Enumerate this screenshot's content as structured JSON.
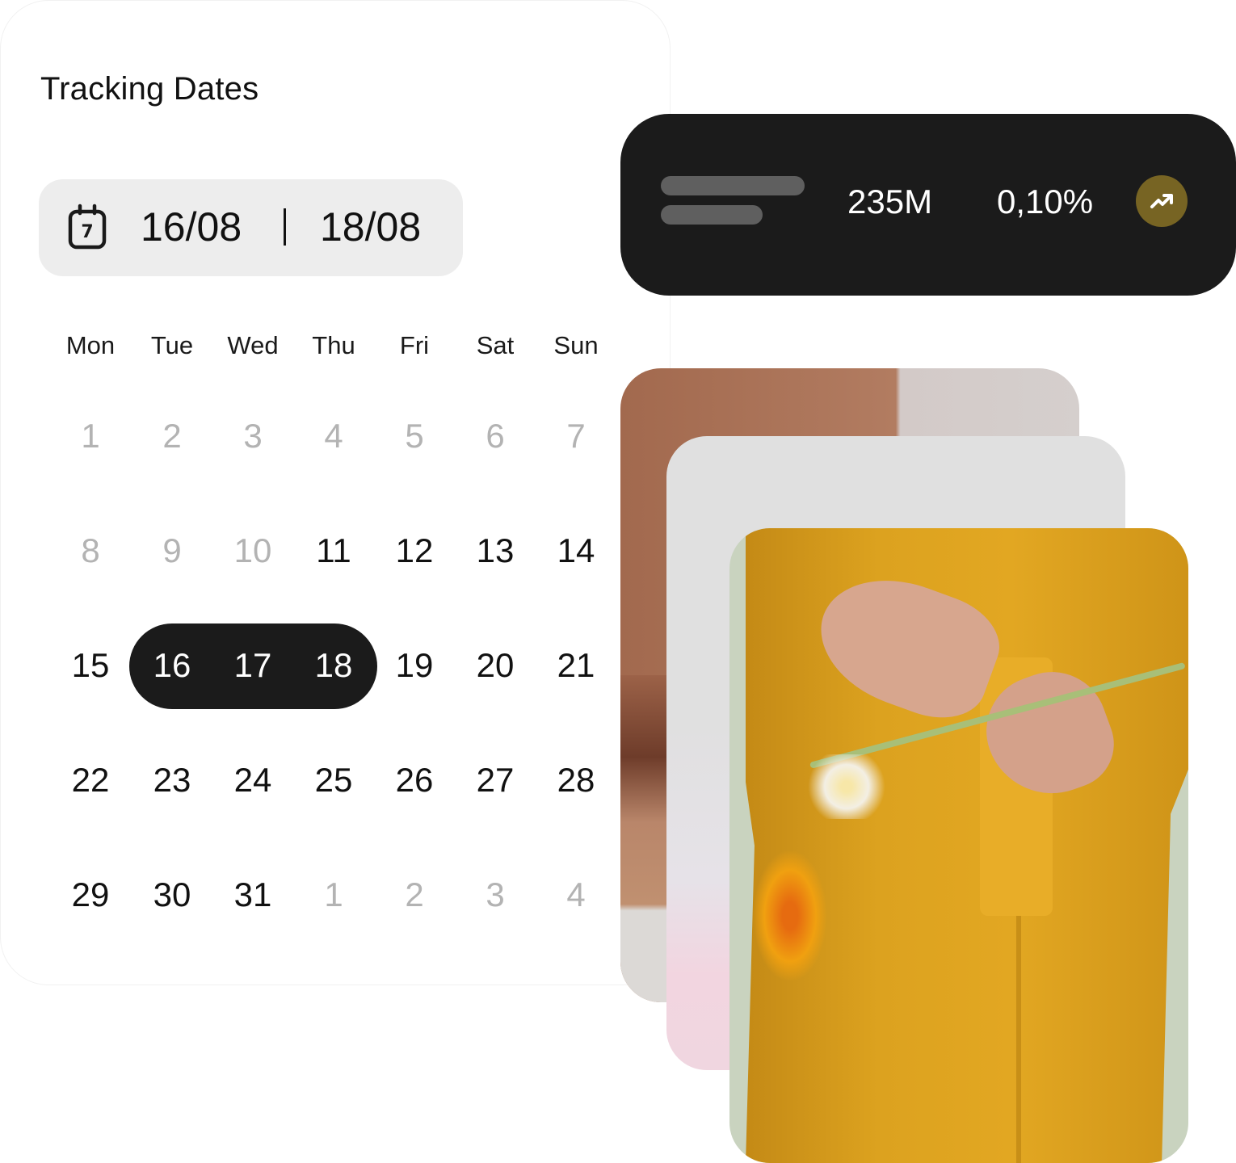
{
  "calendar": {
    "title": "Tracking Dates",
    "range": {
      "icon": "calendar-icon",
      "icon_day": "7",
      "start": "16/08",
      "end": "18/08"
    },
    "weekdays": [
      "Mon",
      "Tue",
      "Wed",
      "Thu",
      "Fri",
      "Sat",
      "Sun"
    ],
    "weeks": [
      [
        {
          "d": "1",
          "s": "muted"
        },
        {
          "d": "2",
          "s": "muted"
        },
        {
          "d": "3",
          "s": "muted"
        },
        {
          "d": "4",
          "s": "muted"
        },
        {
          "d": "5",
          "s": "muted"
        },
        {
          "d": "6",
          "s": "muted"
        },
        {
          "d": "7",
          "s": "muted"
        }
      ],
      [
        {
          "d": "8",
          "s": "muted"
        },
        {
          "d": "9",
          "s": "muted"
        },
        {
          "d": "10",
          "s": "muted"
        },
        {
          "d": "11",
          "s": "normal"
        },
        {
          "d": "12",
          "s": "normal"
        },
        {
          "d": "13",
          "s": "normal"
        },
        {
          "d": "14",
          "s": "normal"
        }
      ],
      [
        {
          "d": "15",
          "s": "normal"
        },
        {
          "d": "16",
          "s": "selected"
        },
        {
          "d": "17",
          "s": "selected"
        },
        {
          "d": "18",
          "s": "selected"
        },
        {
          "d": "19",
          "s": "normal"
        },
        {
          "d": "20",
          "s": "normal"
        },
        {
          "d": "21",
          "s": "normal"
        }
      ],
      [
        {
          "d": "22",
          "s": "normal"
        },
        {
          "d": "23",
          "s": "normal"
        },
        {
          "d": "24",
          "s": "normal"
        },
        {
          "d": "25",
          "s": "normal"
        },
        {
          "d": "26",
          "s": "normal"
        },
        {
          "d": "27",
          "s": "normal"
        },
        {
          "d": "28",
          "s": "normal"
        }
      ],
      [
        {
          "d": "29",
          "s": "normal"
        },
        {
          "d": "30",
          "s": "normal"
        },
        {
          "d": "31",
          "s": "normal"
        },
        {
          "d": "1",
          "s": "muted"
        },
        {
          "d": "2",
          "s": "muted"
        },
        {
          "d": "3",
          "s": "muted"
        },
        {
          "d": "4",
          "s": "muted"
        }
      ]
    ]
  },
  "stat": {
    "value": "235M",
    "change": "0,10%",
    "trend_icon": "trending-up-icon",
    "accent": "#776423"
  },
  "photos": [
    {
      "name": "photo-back",
      "subject": "brown abstract backdrop"
    },
    {
      "name": "photo-middle",
      "subject": "grey and pink backdrop"
    },
    {
      "name": "photo-front",
      "subject": "person in mustard coat holding gerbera flowers"
    }
  ],
  "colors": {
    "selected_bg": "#1b1b1b",
    "muted_text": "#b3b3b3",
    "pill_bg": "#ededed"
  }
}
